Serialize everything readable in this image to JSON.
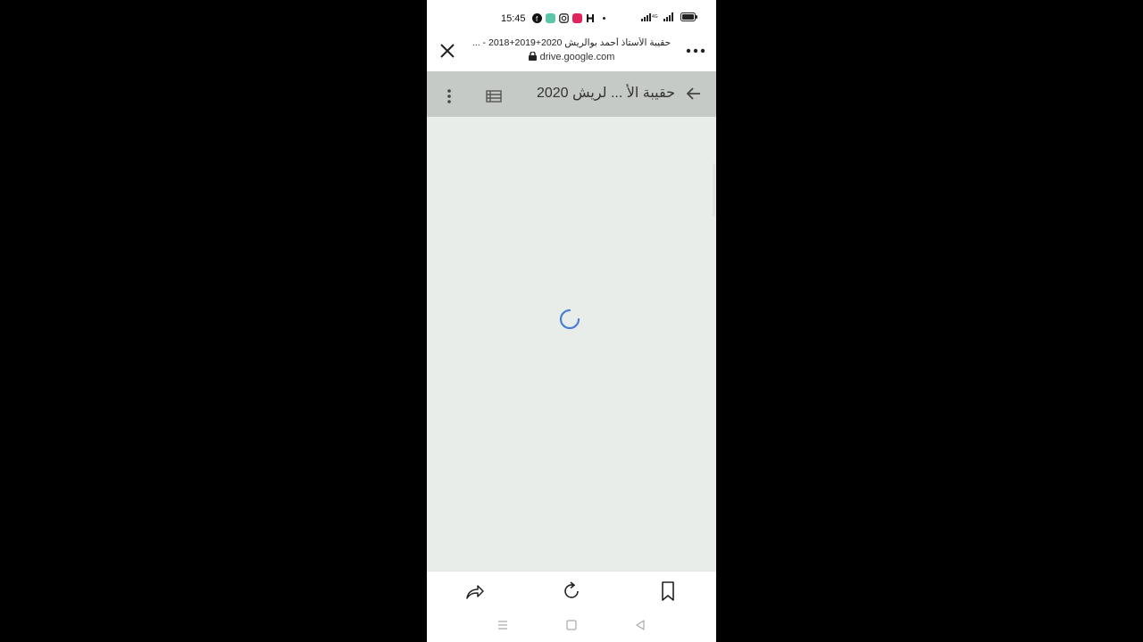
{
  "status_bar": {
    "time": "15:45",
    "apps": [
      {
        "icon": "facebook-icon",
        "color": "#1877f2"
      },
      {
        "icon": "messages-icon",
        "color": "#5cc6a8"
      },
      {
        "icon": "instagram-icon",
        "color": "#444444"
      },
      {
        "icon": "youtube-icon",
        "color": "#e0245e"
      },
      {
        "icon": "h-app-icon",
        "color": "#222222"
      }
    ],
    "indicators": [
      "wifi-icon",
      "signal-icon",
      "battery-icon"
    ]
  },
  "browser": {
    "page_title": "حقيبة الأستاذ أحمد بوالريش 2020+2019+2018 - ...",
    "url": "drive.google.com",
    "close_icon": "close-icon",
    "more_icon": "more-horizontal-icon"
  },
  "drive_toolbar": {
    "folder_title": "حقيبة الأ ... لريش 2020",
    "background": "#c6cac6"
  },
  "content": {
    "state": "loading",
    "background": "#e9edea",
    "spinner_color": "#4a7fd4"
  },
  "bottom_bar": {
    "icons": [
      "share-icon",
      "reload-icon",
      "bookmark-icon"
    ]
  },
  "system_nav": {
    "icons": [
      "recents-icon",
      "home-icon",
      "back-icon"
    ]
  }
}
